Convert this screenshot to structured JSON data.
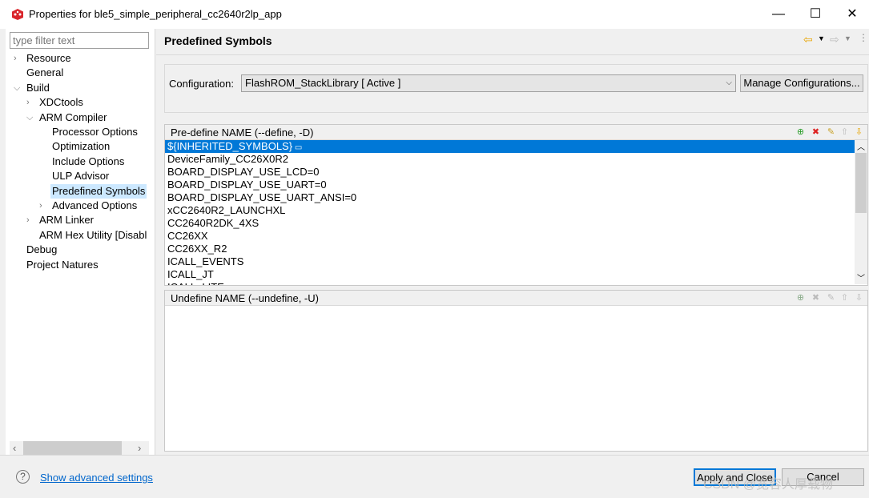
{
  "window": {
    "title": "Properties for ble5_simple_peripheral_cc2640r2lp_app",
    "icons": [
      "app-cube-icon",
      "minimize-icon",
      "maximize-icon",
      "close-icon"
    ]
  },
  "filter": {
    "placeholder": "type filter text"
  },
  "tree": [
    {
      "label": "Resource",
      "level": 0,
      "twisty": "collapsed"
    },
    {
      "label": "General",
      "level": 0,
      "twisty": "none"
    },
    {
      "label": "Build",
      "level": 0,
      "twisty": "expanded"
    },
    {
      "label": "XDCtools",
      "level": 1,
      "twisty": "collapsed"
    },
    {
      "label": "ARM Compiler",
      "level": 1,
      "twisty": "expanded"
    },
    {
      "label": "Processor Options",
      "level": 2,
      "twisty": "none"
    },
    {
      "label": "Optimization",
      "level": 2,
      "twisty": "none"
    },
    {
      "label": "Include Options",
      "level": 2,
      "twisty": "none"
    },
    {
      "label": "ULP Advisor",
      "level": 2,
      "twisty": "none"
    },
    {
      "label": "Predefined Symbols",
      "level": 2,
      "twisty": "none",
      "selected": true
    },
    {
      "label": "Advanced Options",
      "level": 2,
      "twisty": "collapsed"
    },
    {
      "label": "ARM Linker",
      "level": 1,
      "twisty": "collapsed"
    },
    {
      "label": "ARM Hex Utility  [Disabl",
      "level": 1,
      "twisty": "none"
    },
    {
      "label": "Debug",
      "level": 0,
      "twisty": "none"
    },
    {
      "label": "Project Natures",
      "level": 0,
      "twisty": "none"
    }
  ],
  "page": {
    "title": "Predefined Symbols"
  },
  "config": {
    "label": "Configuration:",
    "value": "FlashROM_StackLibrary  [ Active ]",
    "manage_label": "Manage Configurations..."
  },
  "predefine": {
    "header": "Pre-define NAME (--define, -D)",
    "items": [
      "${INHERITED_SYMBOLS}",
      "DeviceFamily_CC26X0R2",
      "BOARD_DISPLAY_USE_LCD=0",
      "BOARD_DISPLAY_USE_UART=0",
      "BOARD_DISPLAY_USE_UART_ANSI=0",
      "xCC2640R2_LAUNCHXL",
      "CC2640R2DK_4XS",
      "CC26XX",
      "CC26XX_R2",
      "ICALL_EVENTS",
      "ICALL_JT",
      "ICALL_LITE"
    ],
    "selected_index": 0
  },
  "undefine": {
    "header": "Undefine NAME (--undefine, -U)",
    "items": []
  },
  "footer": {
    "link": "Show advanced settings",
    "apply_close": "Apply and Close",
    "cancel": "Cancel",
    "watermark": "CSDN @宽容人厚载物"
  },
  "colors": {
    "selection": "#0078d7",
    "tree_selection": "#cce8ff",
    "link": "#0066cc"
  }
}
